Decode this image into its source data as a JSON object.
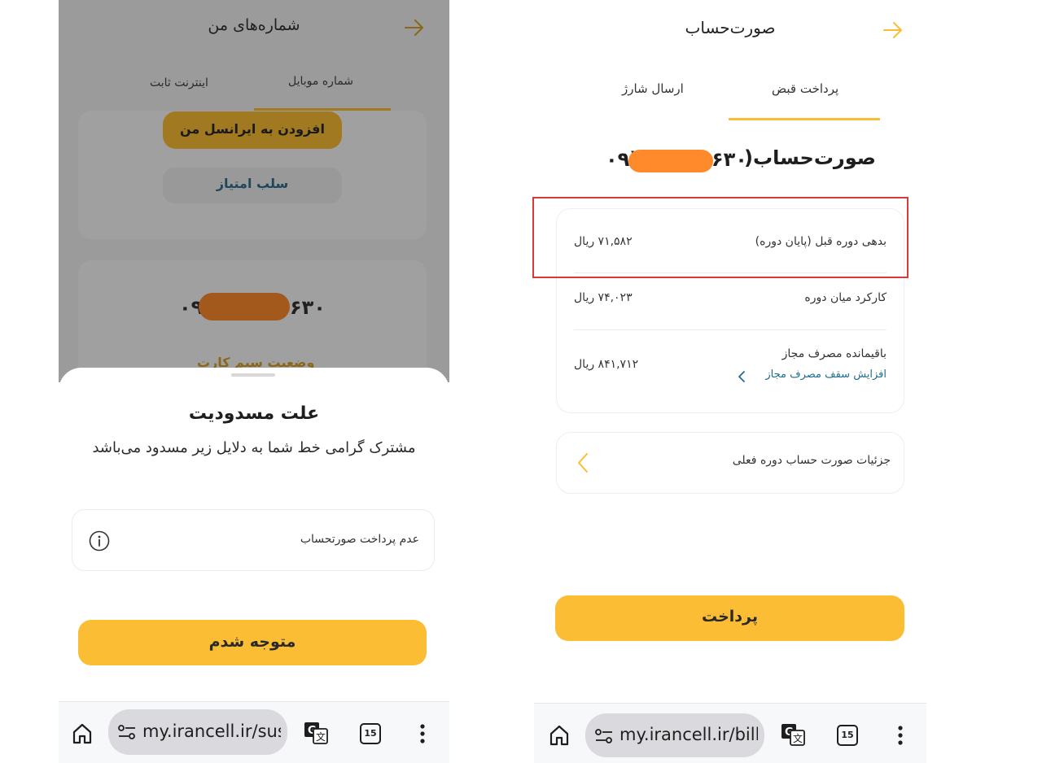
{
  "left": {
    "header": {
      "title": "شماره‌های من"
    },
    "tabs": [
      {
        "label": "شماره موبایل"
      },
      {
        "label": "اینترنت ثابت"
      }
    ],
    "add_button": "افزودن به ایرانسل من",
    "revoke_button": "سلب امتیاز",
    "phone_prefix": "۰۹",
    "phone_suffix": "۶۳۰",
    "sim_status": "وضعیت سیم کارت",
    "sheet": {
      "title": "علت مسدودیت",
      "subtitle": "مشترک گرامی خط شما به دلایل زیر مسدود می‌باشد",
      "reason": "عدم پرداخت صورتحساب",
      "confirm_button": "متوجه شدم"
    },
    "browser": {
      "url": "my.irancell.ir/susp",
      "tab_count": "15"
    }
  },
  "right": {
    "header": {
      "title": "صورت‌حساب"
    },
    "tabs": [
      {
        "label": "پرداخت قبض"
      },
      {
        "label": "ارسال شارژ"
      }
    ],
    "bill_heading": "صورت‌حساب(",
    "phone_suffix": "۶۳۰",
    "phone_prefix": "۰۹)",
    "rows": [
      {
        "label": "بدهی دوره قبل (پایان دوره)",
        "value": "۷۱,۵۸۲ ریال"
      },
      {
        "label": "کارکرد میان دوره",
        "value": "۷۴,۰۲۳ ریال"
      },
      {
        "label": "باقیمانده مصرف مجاز",
        "value": "۸۴۱,۷۱۲ ریال",
        "link": "افزایش سقف مصرف مجاز"
      }
    ],
    "details_link": "جزئیات صورت حساب دوره فعلی",
    "pay_button": "پرداخت",
    "browser": {
      "url": "my.irancell.ir/bill/p",
      "tab_count": "15"
    }
  },
  "colors": {
    "accent": "#fbbd33",
    "highlight": "#d83a3a",
    "redaction": "#ff8a2c",
    "link": "#1e6f8f"
  }
}
